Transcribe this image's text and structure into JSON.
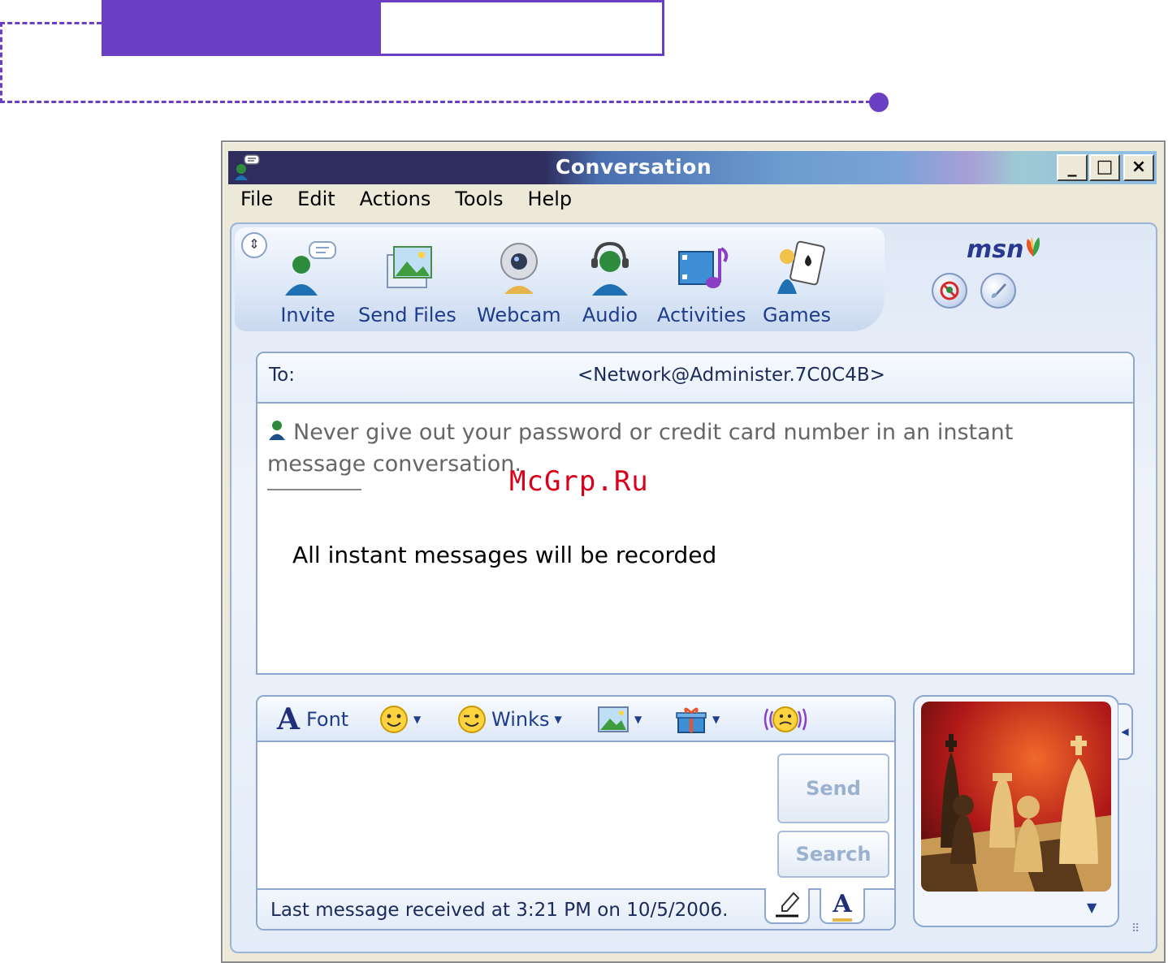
{
  "window": {
    "title": "Conversation",
    "controls": {
      "minimize": "_",
      "maximize": "□",
      "close": "×"
    }
  },
  "menu": [
    "File",
    "Edit",
    "Actions",
    "Tools",
    "Help"
  ],
  "toolbar": {
    "items": [
      {
        "label": "Invite",
        "icon": "invite-icon"
      },
      {
        "label": "Send Files",
        "icon": "send-files-icon"
      },
      {
        "label": "Webcam",
        "icon": "webcam-icon"
      },
      {
        "label": "Audio",
        "icon": "audio-icon"
      },
      {
        "label": "Activities",
        "icon": "activities-icon"
      },
      {
        "label": "Games",
        "icon": "games-icon"
      }
    ],
    "brand": "msn"
  },
  "conversation": {
    "to_label": "To:",
    "to_address": "<Network@Administer.7C0C4B>",
    "warning": "Never give out your password or credit card number in an instant message conversation.",
    "watermark": "McGrp.Ru",
    "message": "All instant messages will be recorded"
  },
  "compose": {
    "font_label": "Font",
    "winks_label": "Winks",
    "send_label": "Send",
    "search_label": "Search",
    "status": "Last message received at 3:21 PM on 10/5/2006."
  },
  "colors": {
    "accent_purple": "#6b3fc4",
    "titlebar_dark": "#2f2d5e",
    "link_blue": "#1f3c8c",
    "watermark_red": "#d9001b"
  }
}
